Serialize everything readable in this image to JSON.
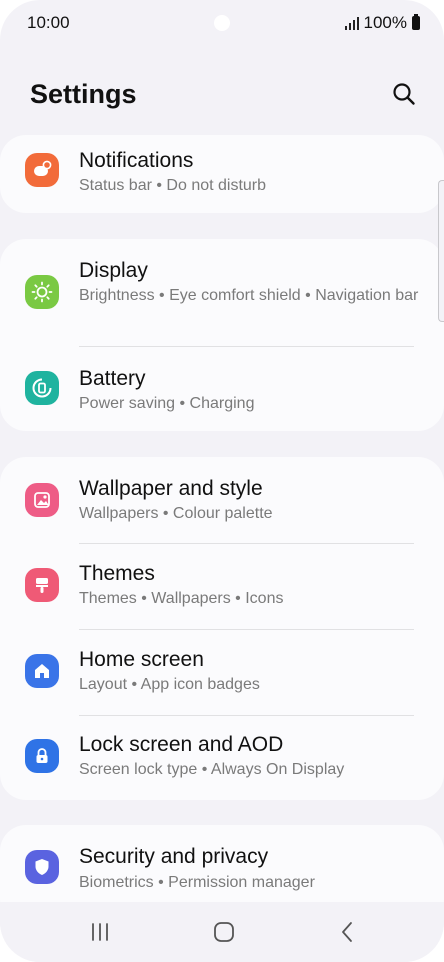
{
  "status_bar": {
    "time": "10:00",
    "battery_percent": "100%"
  },
  "header": {
    "title": "Settings"
  },
  "cards": [
    {
      "items": [
        {
          "title": "Notifications",
          "subtitle": "Status bar  •  Do not disturb",
          "icon": "notifications-icon",
          "color": "#f26b3a"
        }
      ]
    },
    {
      "items": [
        {
          "title": "Display",
          "subtitle": "Brightness  •  Eye comfort shield  •  Navigation bar",
          "icon": "sun-icon",
          "color": "#7ac943"
        },
        {
          "title": "Battery",
          "subtitle": "Power saving  •  Charging",
          "icon": "battery-icon",
          "color": "#1fb39f"
        }
      ]
    },
    {
      "items": [
        {
          "title": "Wallpaper and style",
          "subtitle": "Wallpapers  •  Colour palette",
          "icon": "image-icon",
          "color": "#ee5c86"
        },
        {
          "title": "Themes",
          "subtitle": "Themes  •  Wallpapers  •  Icons",
          "icon": "brush-icon",
          "color": "#ef5a76"
        },
        {
          "title": "Home screen",
          "subtitle": "Layout  •  App icon badges",
          "icon": "home-icon",
          "color": "#3a74e8"
        },
        {
          "title": "Lock screen and AOD",
          "subtitle": "Screen lock type  •  Always On Display",
          "icon": "lock-icon",
          "color": "#2f73e6"
        }
      ]
    },
    {
      "items": [
        {
          "title": "Security and privacy",
          "subtitle": "Biometrics  •  Permission manager",
          "icon": "shield-icon",
          "color": "#5a63e0"
        }
      ]
    }
  ]
}
